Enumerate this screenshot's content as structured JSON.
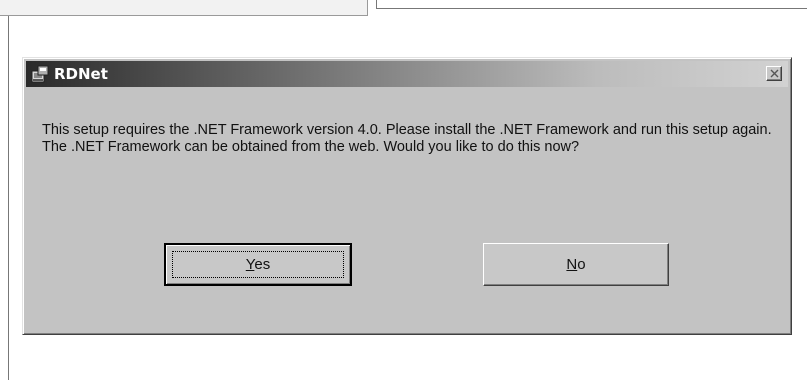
{
  "dialog": {
    "title": "RDNet",
    "icon": "installer-icon",
    "close_icon": "close-icon",
    "message": "This setup requires the .NET Framework version 4.0.  Please install the .NET Framework and run this setup again.  The .NET Framework can be obtained from the web.  Would you like to do this now?",
    "buttons": {
      "yes": {
        "mnemonic": "Y",
        "rest": "es"
      },
      "no": {
        "mnemonic": "N",
        "rest": "o"
      }
    }
  }
}
